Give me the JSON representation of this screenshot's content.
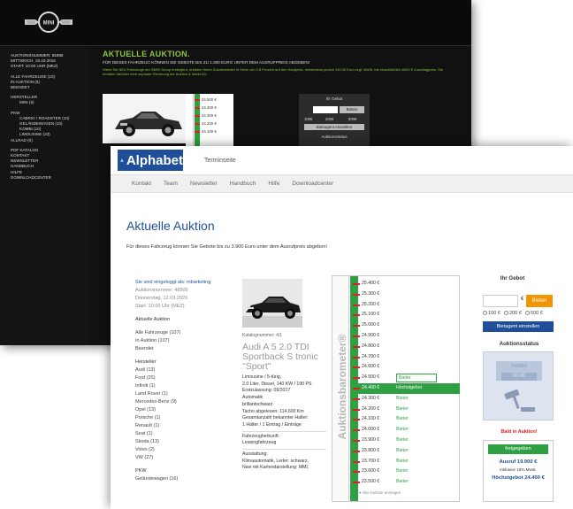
{
  "back": {
    "auction_lines": [
      "AUKTIONSNUMMER: 55998",
      "MITTWOCH, 19.10.2016",
      "START: 10:00 UHR (MEZ)"
    ],
    "nav": [
      {
        "label": "ALLE FAHRZEUGE (10)",
        "indent": false
      },
      {
        "label": "IN AUKTION (6)",
        "indent": false
      },
      {
        "label": "BEENDET",
        "indent": false
      },
      {
        "label": "HERSTELLER",
        "indent": false,
        "gap": true
      },
      {
        "label": "MINI (6)",
        "indent": true
      },
      {
        "label": "PKW",
        "indent": false,
        "gap": true
      },
      {
        "label": "CABRIO / ROADSTER (10)",
        "indent": true
      },
      {
        "label": "GELÄNDEWAGEN (10)",
        "indent": true
      },
      {
        "label": "KOMBI (10)",
        "indent": true
      },
      {
        "label": "LIMOUSINE (23)",
        "indent": true
      },
      {
        "label": "ALLRAD (0)",
        "indent": false
      },
      {
        "label": "PDF KATALOG",
        "indent": false,
        "gap": true
      },
      {
        "label": "KONTAKT",
        "indent": false
      },
      {
        "label": "NEWSLETTER",
        "indent": false
      },
      {
        "label": "HANDBUCH",
        "indent": false
      },
      {
        "label": "HILFE",
        "indent": false
      },
      {
        "label": "DOWNLOADCENTER",
        "indent": false
      }
    ],
    "title": "AKTUELLE AUKTION.",
    "subtitle": "FÜR DIESES FAHRZEUG KÖNNEN SIE GEBOTE BIS ZU 1.000 EURO UNTER DEM AUSRUFPREIS ABGEBEN!",
    "note": "Wenn Sie NEU Fahrzeuge der BMW Group ersteigern, erklären Ihnen Zusatzmeister in Höhe von 0,8 Prozent auf den Kaufpreis, mindestens jedoch 110,00 Euro zzgl. MwSt. bis einschließlich 8000 € Zuschlagpreis. Sie erhalten hierüber eine separate Rechnung der Auktion & Markt AG.",
    "barometer": [
      "24.500 €",
      "24.400 €",
      "24.300 €",
      "24.200 €",
      "24.100 €"
    ],
    "bid": {
      "title": "Ihr Gebot",
      "currency": "€",
      "button": "Bieten",
      "options": [
        "100€",
        "200€",
        "500€"
      ],
      "set_label": "Biebagent einstellen",
      "status_label": "Auktionsstatus"
    }
  },
  "front": {
    "brand": "Alphabet",
    "tab": "Terminseite",
    "nav": [
      "Kontakt",
      "Team",
      "Newsletter",
      "Handbuch",
      "Hilfe",
      "Downloadcenter"
    ],
    "title": "Aktuelle Auktion",
    "intro": "Für dieses Fahrzeug können Sie Gebote bis zu 3.900 Euro unter dem Ausrufpreis abgeben!",
    "sidebar": {
      "login": "Sie sind eingeloggt als: mbarketing",
      "auction": [
        "Auktionsnummer: 48505",
        "Donnerstag, 12.03.2020",
        "Start: 10:00 Uhr (MEZ)"
      ],
      "section": "Aktuelle Auktion",
      "filters": [
        "Alle Fahrzeuge (107)",
        "In Auktion (107)",
        "Beendet"
      ],
      "maker_head": "Hersteller",
      "makers": [
        "Audi (13)",
        "Ford (25)",
        "Infiniti (1)",
        "Land Rover (1)",
        "Mercedes-Benz (9)",
        "Opel (13)",
        "Porsche (1)",
        "Renault (1)",
        "Seat (1)",
        "Skoda (13)",
        "Volvo (2)",
        "VW (27)"
      ],
      "pkw_head": "PKW",
      "pkw": [
        "Geländewagen (16)"
      ]
    },
    "vehicle": {
      "katalog": "Katalognummer: 4/1",
      "model": "Audi A 5 2.0 TDI Sportback S tronic \"Sport\"",
      "specs": [
        "Limousine / 5-türig,",
        "2.0 Liter, Diesel, 140 KW / 190 PS",
        "Erstzulassung: 09/2017",
        "Automatik",
        "brillantschwarz",
        "Tacho abgelesen: 114.600  Km",
        "Gesamtanzahl bekannter Halter:",
        "1 Halter / 1 Eintrag / Einträge"
      ],
      "specs2": [
        "Fahrzeugherkunft:",
        "Leasingfahrzeug"
      ],
      "specs3": [
        "Ausstattung:",
        "Klimaautomatik, Leder: schwarz,",
        "Navi mit Kartendarstellung: MMI,"
      ]
    },
    "barometer": {
      "label": "Auktionsbarometer®",
      "rows": [
        {
          "v": "25.400 €",
          "t": ""
        },
        {
          "v": "25.300 €",
          "t": ""
        },
        {
          "v": "25.200 €",
          "t": ""
        },
        {
          "v": "25.100 €",
          "t": ""
        },
        {
          "v": "25.000 €",
          "t": ""
        },
        {
          "v": "24.900 €",
          "t": ""
        },
        {
          "v": "24.800 €",
          "t": ""
        },
        {
          "v": "24.700 €",
          "t": ""
        },
        {
          "v": "24.600 €",
          "t": ""
        },
        {
          "v": "24.500 €",
          "t": "Bieter",
          "box": true
        },
        {
          "v": "24.400 €",
          "t": "Höchstgebot",
          "hi": true
        },
        {
          "v": "24.300 €",
          "t": "Bieter"
        },
        {
          "v": "24.200 €",
          "t": "Bieter"
        },
        {
          "v": "24.100 €",
          "t": "Bieter"
        },
        {
          "v": "24.000 €",
          "t": "Bieter"
        },
        {
          "v": "23.900 €",
          "t": "Bieter"
        },
        {
          "v": "23.800 €",
          "t": "Bieter"
        },
        {
          "v": "23.700 €",
          "t": "Bieter"
        },
        {
          "v": "23.600 €",
          "t": "Bieter"
        },
        {
          "v": "23.500 €",
          "t": "Bieter"
        }
      ],
      "more": "Alle Gebote anzeigen"
    },
    "bid": {
      "title": "Ihr Gebot",
      "currency": "€",
      "button": "Bieten",
      "options": [
        "100 €",
        "200 €",
        "500 €"
      ],
      "set_label": "Bietagent einstellen",
      "status_title": "Auktionsstatus",
      "lcd_top": "Hotbid",
      "lcd_time": "00:00",
      "soon": "Bald in Auktion!",
      "released": "freigegeben",
      "ausruf": "Ausruf 19.900 €",
      "mwst": "inklusive 19% Mwst.",
      "hoechst": "Höchstgebot 24.400 €"
    }
  }
}
